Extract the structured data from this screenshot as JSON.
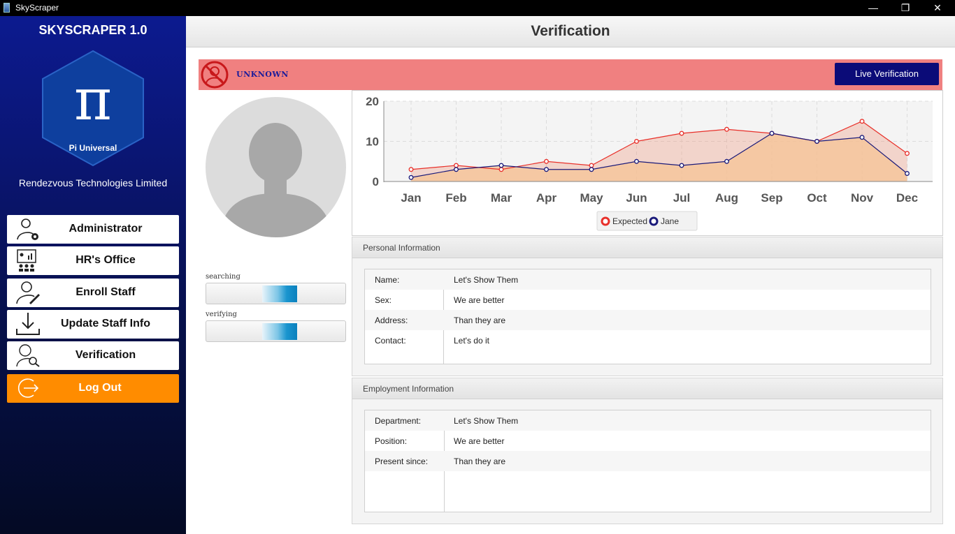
{
  "window": {
    "title": "SkyScraper",
    "min": "—",
    "max": "❐",
    "close": "✕"
  },
  "sidebar": {
    "app_name": "SKYSCRAPER 1.0",
    "logo_text": "Pi Universal",
    "logo_symbol": "π",
    "company": "Rendezvous Technologies Limited",
    "items": [
      {
        "label": "Administrator",
        "icon": "admin-gear-icon"
      },
      {
        "label": "HR's Office",
        "icon": "presentation-icon"
      },
      {
        "label": "Enroll Staff",
        "icon": "user-edit-icon"
      },
      {
        "label": "Update Staff Info",
        "icon": "download-icon"
      },
      {
        "label": "Verification",
        "icon": "user-search-icon"
      }
    ],
    "logout": {
      "label": "Log Out",
      "icon": "logout-icon"
    },
    "accent": "#ff8c00"
  },
  "header": {
    "title": "Verification"
  },
  "status": {
    "text": "UNKNOWN",
    "icon": "unknown-user-icon",
    "color": "#f08080",
    "button": "Live Verification"
  },
  "progress": {
    "searching": {
      "label": "searching"
    },
    "verifying": {
      "label": "verifying"
    }
  },
  "chart_data": {
    "type": "area",
    "categories": [
      "Jan",
      "Feb",
      "Mar",
      "Apr",
      "May",
      "Jun",
      "Jul",
      "Aug",
      "Sep",
      "Oct",
      "Nov",
      "Dec"
    ],
    "series": [
      {
        "name": "Expected",
        "color": "#e8302a",
        "values": [
          3,
          4,
          3,
          5,
          4,
          10,
          12,
          13,
          12,
          10,
          15,
          7
        ]
      },
      {
        "name": "Jane",
        "color": "#1a1a7a",
        "values": [
          1,
          3,
          4,
          3,
          3,
          5,
          4,
          5,
          12,
          10,
          11,
          2
        ]
      }
    ],
    "y_ticks": [
      "0",
      "10",
      "20"
    ],
    "ylim": [
      0,
      20
    ],
    "grid": true,
    "legend": "bottom"
  },
  "personal": {
    "title": "Personal Information",
    "rows": [
      {
        "k": "Name:",
        "v": "Let's Show Them"
      },
      {
        "k": "Sex:",
        "v": "We are better"
      },
      {
        "k": "Address:",
        "v": "Than they are"
      },
      {
        "k": "Contact:",
        "v": "Let's do it"
      }
    ]
  },
  "employment": {
    "title": "Employment Information",
    "rows": [
      {
        "k": "Department:",
        "v": "Let's Show Them"
      },
      {
        "k": "Position:",
        "v": "We are better"
      },
      {
        "k": "Present since:",
        "v": "Than they are"
      }
    ]
  }
}
